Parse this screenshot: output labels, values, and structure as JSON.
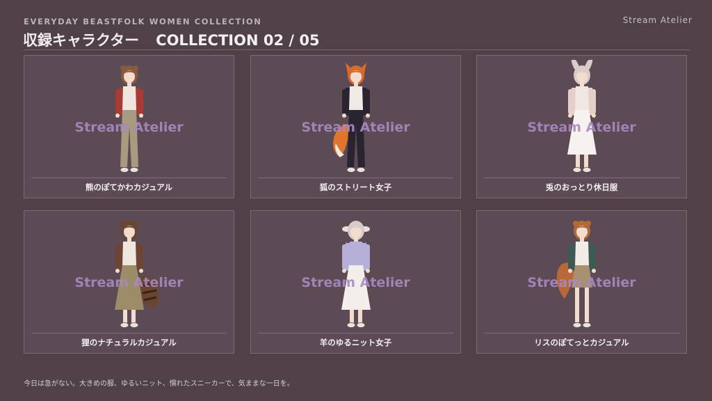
{
  "header": {
    "eyebrow": "EVERYDAY BEASTFOLK WOMEN COLLECTION",
    "title_jp": "収録キャラクター",
    "title_en": "COLLECTION 02 / 05",
    "brand": "Stream Atelier"
  },
  "watermark": "Stream Atelier",
  "cards": [
    {
      "caption": "熊のぽてかわカジュアル",
      "hair": "#8a5a3c",
      "top": "#efe7df",
      "jacket": "#a83a34",
      "bottom": "#a79a80",
      "ear": "round",
      "tail": "none"
    },
    {
      "caption": "狐のストリート女子",
      "hair": "#d86a2c",
      "top": "#eeeae6",
      "jacket": "#2a2430",
      "bottom": "#2a2430",
      "ear": "fox",
      "tail": "fox"
    },
    {
      "caption": "兎のおっとり休日服",
      "hair": "#d9ccc8",
      "top": "#f2e6e2",
      "jacket": "#e6cfc9",
      "bottom": "#f6f2f0",
      "ear": "rabbit",
      "tail": "none"
    },
    {
      "caption": "狸のナチュラルカジュアル",
      "hair": "#6a4632",
      "top": "#efe7df",
      "jacket": "#6e4434",
      "bottom": "#9c8c68",
      "ear": "round",
      "tail": "tanuki"
    },
    {
      "caption": "羊のゆるニット女子",
      "hair": "#d4ccc8",
      "top": "#b6b0d8",
      "jacket": "#b6b0d8",
      "bottom": "#f2eeea",
      "ear": "sheep",
      "tail": "none"
    },
    {
      "caption": "リスのぽてっとカジュアル",
      "hair": "#b06a3a",
      "top": "#f2ece6",
      "jacket": "#3c5a52",
      "bottom": "#a89070",
      "ear": "round",
      "tail": "squirrel"
    }
  ],
  "footer": "今日は急がない。大きめの服、ゆるいニット、慣れたスニーカーで、気ままな一日を。",
  "colors": {
    "background": "#504048",
    "card": "#5c4b54",
    "watermark": "#a98ac2"
  }
}
